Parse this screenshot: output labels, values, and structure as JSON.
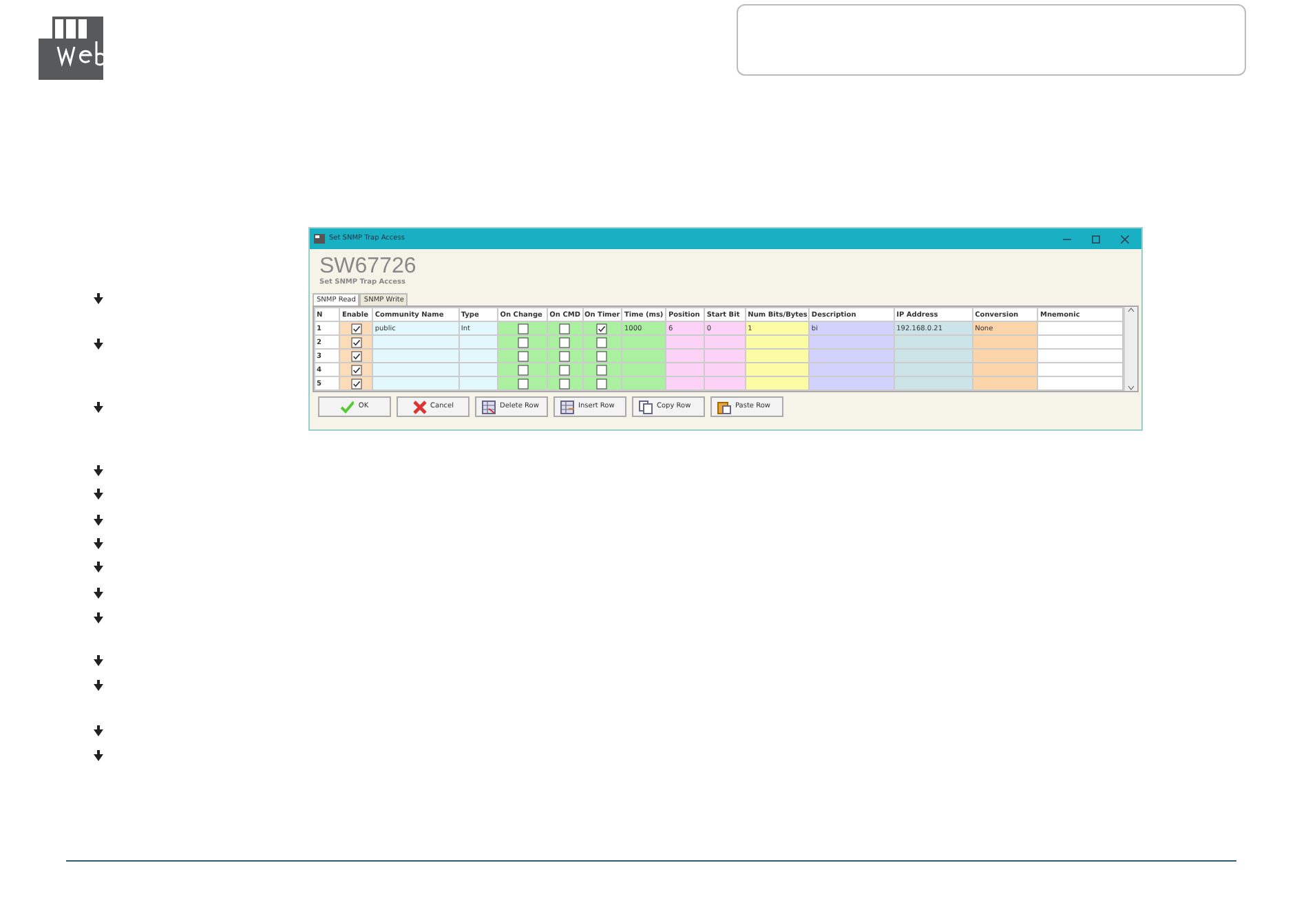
{
  "window": {
    "title": "Set SNMP Trap Access"
  },
  "header": {
    "code": "SW67726",
    "subtitle": "Set SNMP Trap Access"
  },
  "tabs": [
    {
      "label": "SNMP Read",
      "selected": true
    },
    {
      "label": "SNMP Write",
      "selected": false
    }
  ],
  "table": {
    "columns": [
      {
        "label": "N",
        "kind": "text",
        "color": "#ffffff"
      },
      {
        "label": "Enable",
        "kind": "checkbox",
        "color": "#fcdcb8"
      },
      {
        "label": "Community Name",
        "kind": "text",
        "color": "#e2f8fc"
      },
      {
        "label": "Type",
        "kind": "text",
        "color": "#e2f8fc"
      },
      {
        "label": "On Change",
        "kind": "checkbox",
        "color": "#aaf0a0"
      },
      {
        "label": "On CMD",
        "kind": "checkbox",
        "color": "#aaf0a0"
      },
      {
        "label": "On Timer",
        "kind": "checkbox",
        "color": "#aaf0a0"
      },
      {
        "label": "Time (ms)",
        "kind": "text",
        "color": "#aaf0a0"
      },
      {
        "label": "Position",
        "kind": "text",
        "color": "#fcd2f6"
      },
      {
        "label": "Start Bit",
        "kind": "text",
        "color": "#fcd2f6"
      },
      {
        "label": "Num Bits/Bytes",
        "kind": "text",
        "color": "#fcfca4"
      },
      {
        "label": "Description",
        "kind": "text",
        "color": "#d2d2fc"
      },
      {
        "label": "IP Address",
        "kind": "text",
        "color": "#cce4e8"
      },
      {
        "label": "Conversion",
        "kind": "text",
        "color": "#fcd4aa"
      },
      {
        "label": "Mnemonic",
        "kind": "text",
        "color": "#ffffff"
      }
    ],
    "rows": [
      {
        "cells": [
          {
            "text": "1"
          },
          {
            "checked": true
          },
          {
            "text": "public"
          },
          {
            "text": "Int"
          },
          {
            "checked": false
          },
          {
            "checked": false
          },
          {
            "checked": true
          },
          {
            "text": "1000"
          },
          {
            "text": "6"
          },
          {
            "text": "0"
          },
          {
            "text": "1"
          },
          {
            "text": "bi"
          },
          {
            "text": "192.168.0.21"
          },
          {
            "text": "None"
          },
          {}
        ]
      },
      {
        "cells": [
          {
            "text": "2"
          },
          {
            "checked": true
          },
          {},
          {},
          {
            "checked": false
          },
          {
            "checked": false
          },
          {
            "checked": false
          },
          {},
          {},
          {},
          {},
          {},
          {},
          {},
          {}
        ]
      },
      {
        "cells": [
          {
            "text": "3"
          },
          {
            "checked": true
          },
          {},
          {},
          {
            "checked": false
          },
          {
            "checked": false
          },
          {
            "checked": false
          },
          {},
          {},
          {},
          {},
          {},
          {},
          {},
          {}
        ]
      },
      {
        "cells": [
          {
            "text": "4"
          },
          {
            "checked": true
          },
          {},
          {},
          {
            "checked": false
          },
          {
            "checked": false
          },
          {
            "checked": false
          },
          {},
          {},
          {},
          {},
          {},
          {},
          {},
          {}
        ]
      },
      {
        "cells": [
          {
            "text": "5"
          },
          {
            "checked": true
          },
          {},
          {},
          {
            "checked": false
          },
          {
            "checked": false
          },
          {
            "checked": false
          },
          {},
          {},
          {},
          {},
          {},
          {},
          {},
          {}
        ]
      }
    ]
  },
  "buttons": [
    {
      "label": "OK",
      "kind": "ok"
    },
    {
      "label": "Cancel",
      "kind": "cancel"
    },
    {
      "label": "Delete Row",
      "kind": "delete"
    },
    {
      "label": "Insert Row",
      "kind": "insert"
    },
    {
      "label": "Copy Row",
      "kind": "copy"
    },
    {
      "label": "Paste Row",
      "kind": "paste"
    }
  ]
}
